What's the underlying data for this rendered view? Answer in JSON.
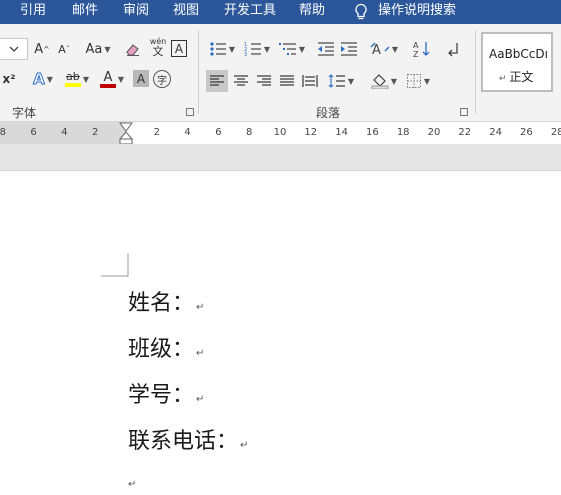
{
  "tabs": [
    "引用",
    "邮件",
    "审阅",
    "视图",
    "开发工具",
    "帮助"
  ],
  "tell_me": "操作说明搜索",
  "font_group": {
    "label": "字体",
    "grow_font": "A",
    "shrink_font": "A",
    "change_case": "Aa",
    "phonetic_guide": "wén",
    "phonetic_char": "文",
    "char_border": "A",
    "superscript": "x²",
    "text_effects": "A",
    "highlight": "ab",
    "font_color": "A",
    "char_shading": "A",
    "enclose_char": "字"
  },
  "paragraph_group": {
    "label": "段落",
    "sort_label": "A↓Z"
  },
  "styles": {
    "preview": "AaBbCcDı",
    "name": "正文"
  },
  "ruler": {
    "left_numbers": [
      "8",
      "6",
      "4",
      "2"
    ],
    "right_numbers": [
      "2",
      "4",
      "6",
      "8",
      "10",
      "12",
      "14",
      "16",
      "18",
      "20",
      "22",
      "24",
      "26",
      "28"
    ]
  },
  "document": {
    "lines": [
      "姓名：",
      "班级：",
      "学号：",
      "联系电话："
    ]
  },
  "colors": {
    "tab_bar": "#2b579a",
    "highlight": "#ffff00",
    "font_color": "#c00000",
    "selected_button": "#c8c8c8"
  }
}
